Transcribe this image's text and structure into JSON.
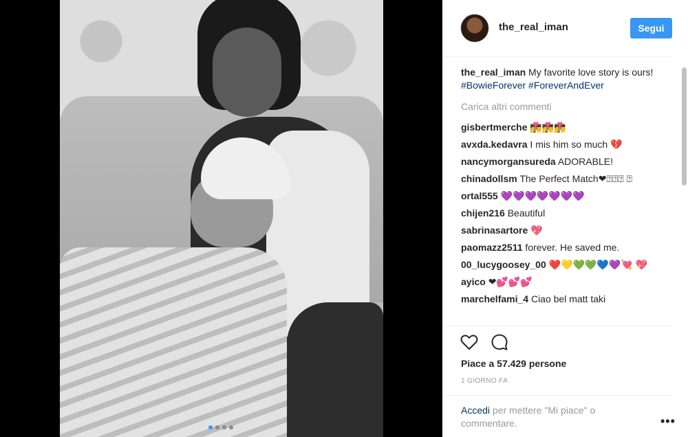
{
  "post": {
    "username": "the_real_iman",
    "follow_label": "Segui",
    "caption": {
      "user": "the_real_iman",
      "text": " My favorite love story is ours! ",
      "hashtags": [
        "#BowieForever",
        "#ForeverAndEver"
      ]
    },
    "load_more_label": "Carica altri commenti",
    "comments": [
      {
        "user": "gisbertmerche",
        "text": " 👩‍❤️‍💋‍👨👩‍❤️‍💋‍👨👩‍❤️‍💋‍👨"
      },
      {
        "user": "avxda.kedavra",
        "text": " I mis him so much 💔"
      },
      {
        "user": "nancymorgansureda",
        "text": " ADORABLE!"
      },
      {
        "user": "chinadollsm",
        "text": " The Perfect Match❤⍰⍰⍰ ⍰"
      },
      {
        "user": "ortal555",
        "text": " 💜💜💜💜💜💜💜"
      },
      {
        "user": "chijen216",
        "text": " Beautiful"
      },
      {
        "user": "sabrinasartore",
        "text": " 💖"
      },
      {
        "user": "paomazz2511",
        "text": " forever. He saved me."
      },
      {
        "user": "00_lucygoosey_00",
        "text": " ❤️💛💚💚💙💜💘 💖"
      },
      {
        "user": "ayico",
        "text": " ❤💕💕💕"
      },
      {
        "user": "marchelfami_4",
        "text": " Ciao bel matt taki"
      }
    ],
    "likes_text": "Piace a 57.429 persone",
    "timestamp": "1 GIORNO FA",
    "login_prompt": {
      "link": "Accedi",
      "text": " per mettere \"Mi piace\" o commentare."
    },
    "more_icon": "•••"
  },
  "carousel": {
    "count": 4,
    "active_index": 0
  },
  "icons": {
    "heart": "heart-outline",
    "comment": "speech-bubble-outline",
    "more": "ellipsis"
  },
  "colors": {
    "follow_button": "#3897f0",
    "hashtag": "#003569",
    "muted": "#999999"
  }
}
